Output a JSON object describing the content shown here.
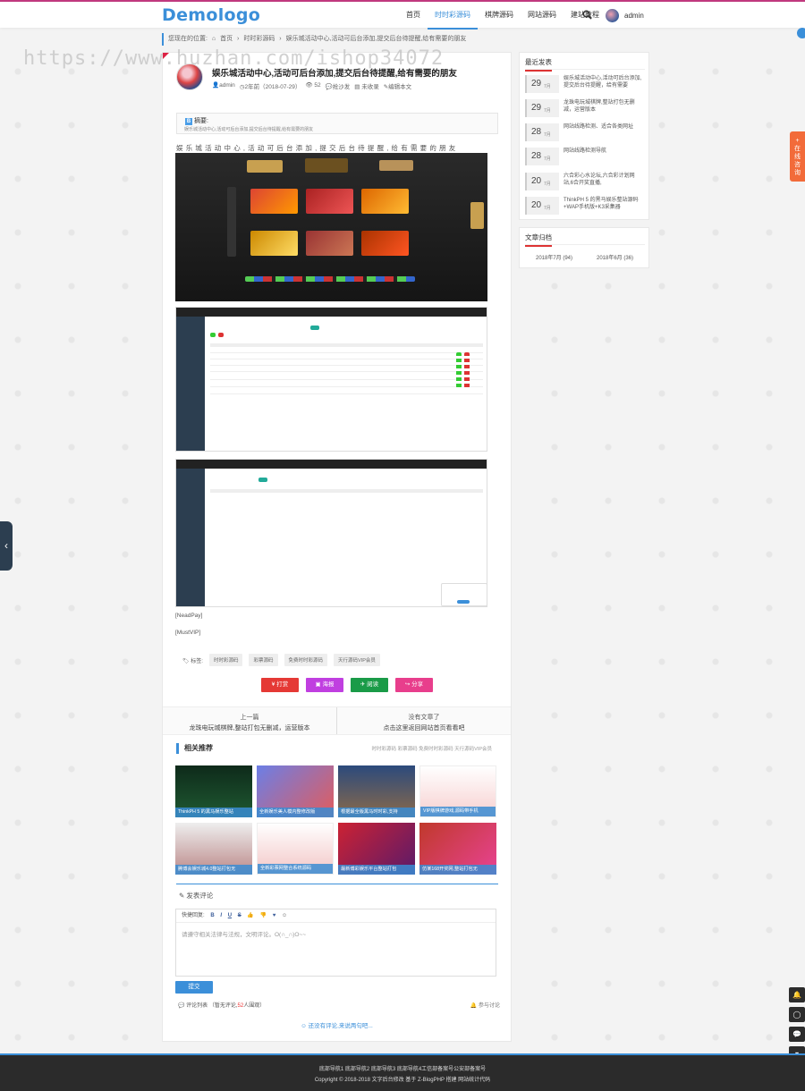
{
  "header": {
    "logo": "Demologo",
    "nav": [
      "首页",
      "时时彩源码",
      "棋牌源码",
      "网站源码",
      "建站教程"
    ],
    "active_nav": 1,
    "user": "admin"
  },
  "breadcrumb": [
    "您现在的位置:",
    "首页",
    "时时彩源码",
    "娱乐城活动中心,活动可后台添加,提交后台待提醒,给有需要的朋友"
  ],
  "watermark": "https://www.huzhan.com/ishop34072",
  "article": {
    "title": "娱乐城活动中心,活动可后台添加,提交后台待提醒,给有需要的朋友",
    "meta": [
      "admin",
      "2年前（2018-07-29）",
      "52",
      "抢沙发",
      "未收录",
      "编辑本文"
    ],
    "abstract_label": "摘要:",
    "abstract_text": "娱乐城活动中心,活动可后台添加,提交后台待提醒,给有需要的朋友",
    "lead": "娱乐城活动中心,活动可后台添加,提交后台待提醒,给有需要的朋友",
    "note1": "[NeadPay]",
    "note2": "[MustVIP]",
    "tags_label": "标签:",
    "tags": [
      "时时彩源码",
      "彩票源码",
      "免费时时彩源码",
      "天行源码VIP会员"
    ],
    "actions": [
      "打赏",
      "海报",
      "阅读",
      "分享"
    ]
  },
  "prev_next": {
    "prev_label": "上一篇",
    "prev_title": "龙珠电玩城棋牌,整站打包无删减，运营版本",
    "next_label": "没有文章了",
    "next_title": "点击这里返回网站首页看看吧"
  },
  "related": {
    "title": "相关推荐",
    "tags": "时时彩源码 彩票源码 免费时时彩源码 天行源码VIP会员",
    "items": [
      "ThinkPH 5 的黑马娱乐整站",
      "全新娱乐美人模内整修改版",
      "根据最全版黑马时时彩,支持",
      "VIP版棋牌游戏,源码带手机",
      "腾博会娱乐城4.0整站打包无",
      "全新彩票网整合系统源码",
      "最新博彩娱乐平台整站打包",
      "仿某168开奖网,整站打包无"
    ]
  },
  "comment": {
    "label": "发表评论",
    "toolbar_label": "快捷回复:",
    "toolbar": [
      "B",
      "I",
      "U",
      "S",
      "👍",
      "👎",
      "♥",
      "☺"
    ],
    "placeholder": "请遵守相关法律与法规，文明评论。O(∩_∩)O~~",
    "submit": "提交",
    "list_label": "评论列表",
    "list_count_pre": "（暂无评论,",
    "list_count": "52",
    "list_count_post": "人围观）",
    "participants": "参与讨论",
    "empty": "还没有评论,来说两句吧..."
  },
  "sidebar": {
    "recent_title": "最近发表",
    "recent": [
      {
        "day": "29",
        "month": "7月",
        "title": "娱乐城活动中心,活动可后台添加,提交后台待提醒，给有需要"
      },
      {
        "day": "29",
        "month": "7月",
        "title": "龙珠电玩城棋牌,整站打包无删减，运营版本"
      },
      {
        "day": "28",
        "month": "7月",
        "title": "网站线路检测、适合各类网址"
      },
      {
        "day": "28",
        "month": "7月",
        "title": "网站线路检测导航"
      },
      {
        "day": "20",
        "month": "7月",
        "title": "六合彩心水论坛,六合彩计划网站,6合开奖直播,"
      },
      {
        "day": "20",
        "month": "7月",
        "title": "ThinkPH 5 的黑马娱乐整站源码+WAP手机版+K3采集器"
      }
    ],
    "archive_title": "文章归档",
    "archive": [
      "2018年7月 (94)",
      "2018年6月 (36)"
    ]
  },
  "float": {
    "right_tab": "在线咨询"
  },
  "footer": {
    "links": "底部导航1  底部导航2  底部导航3  底部导航4工信部备案号公安部备案号",
    "copyright": "Copyright © 2018-2018 文字后台修改  基于 Z-BlogPHP 搭建 网站统计代码"
  }
}
